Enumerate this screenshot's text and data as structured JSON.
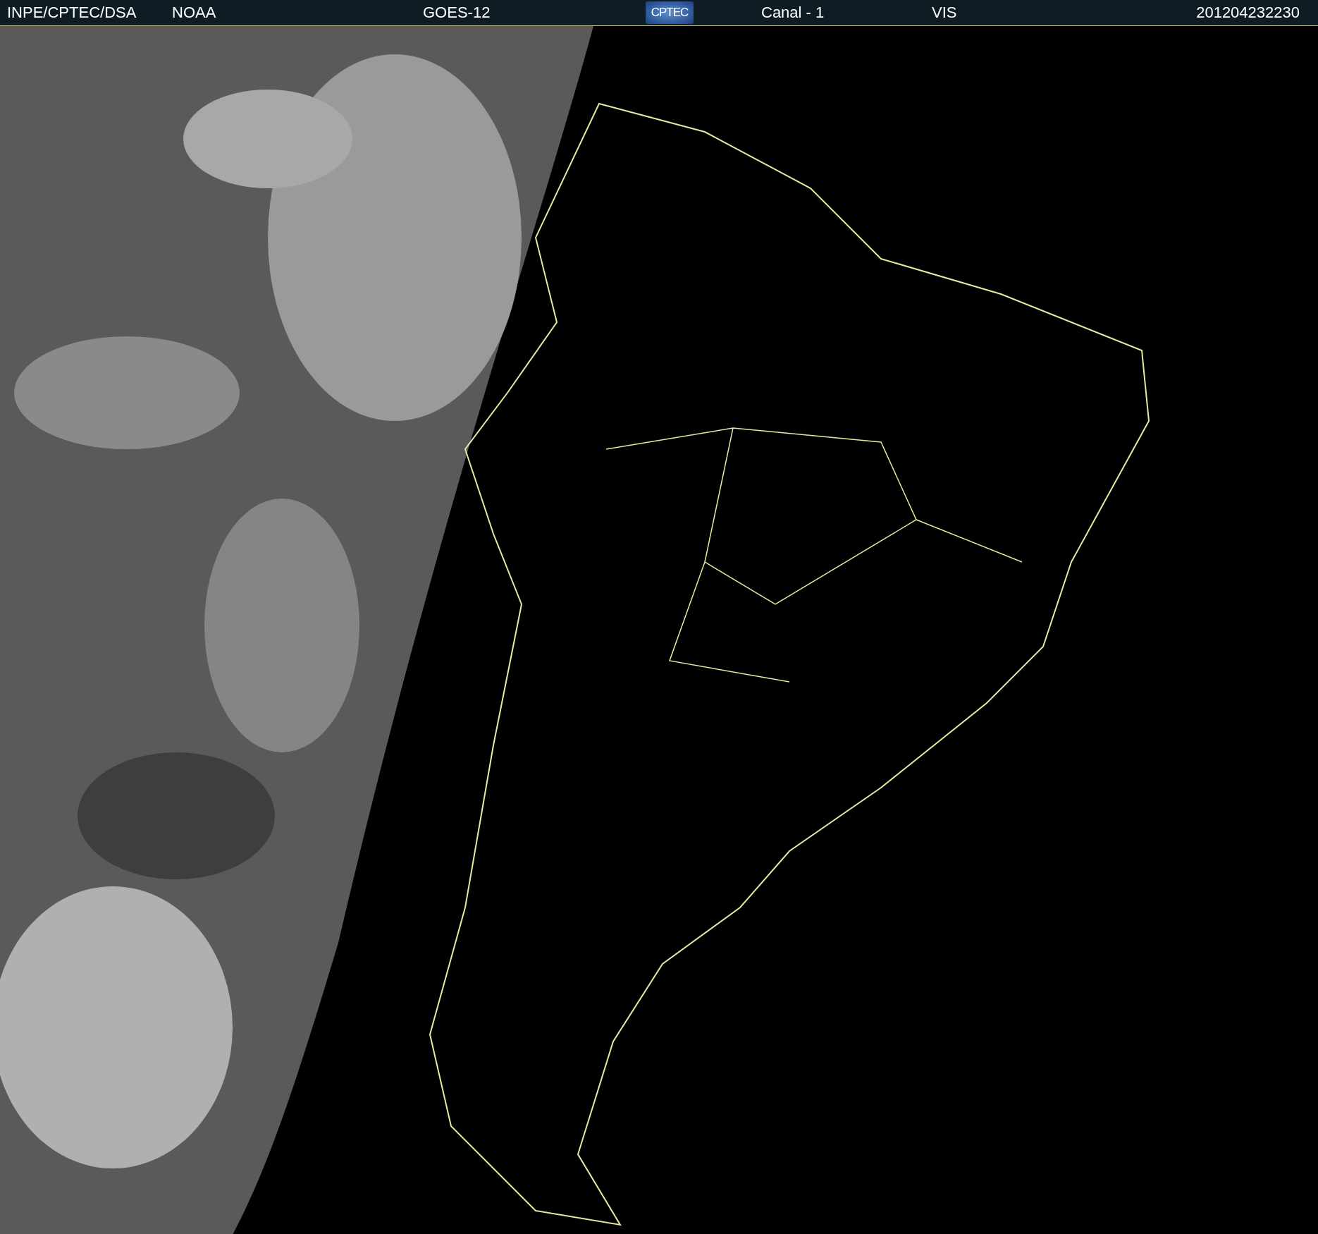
{
  "header": {
    "items": [
      {
        "kind": "text",
        "text": "INPE/CPTEC/DSA"
      },
      {
        "kind": "text",
        "text": "NOAA"
      },
      {
        "kind": "text",
        "text": "GOES-12"
      },
      {
        "kind": "logo",
        "text": "CPTEC"
      },
      {
        "kind": "text",
        "text": "Canal - 1"
      },
      {
        "kind": "text",
        "text": "VIS"
      },
      {
        "kind": "text",
        "text": "201204232230"
      }
    ]
  }
}
